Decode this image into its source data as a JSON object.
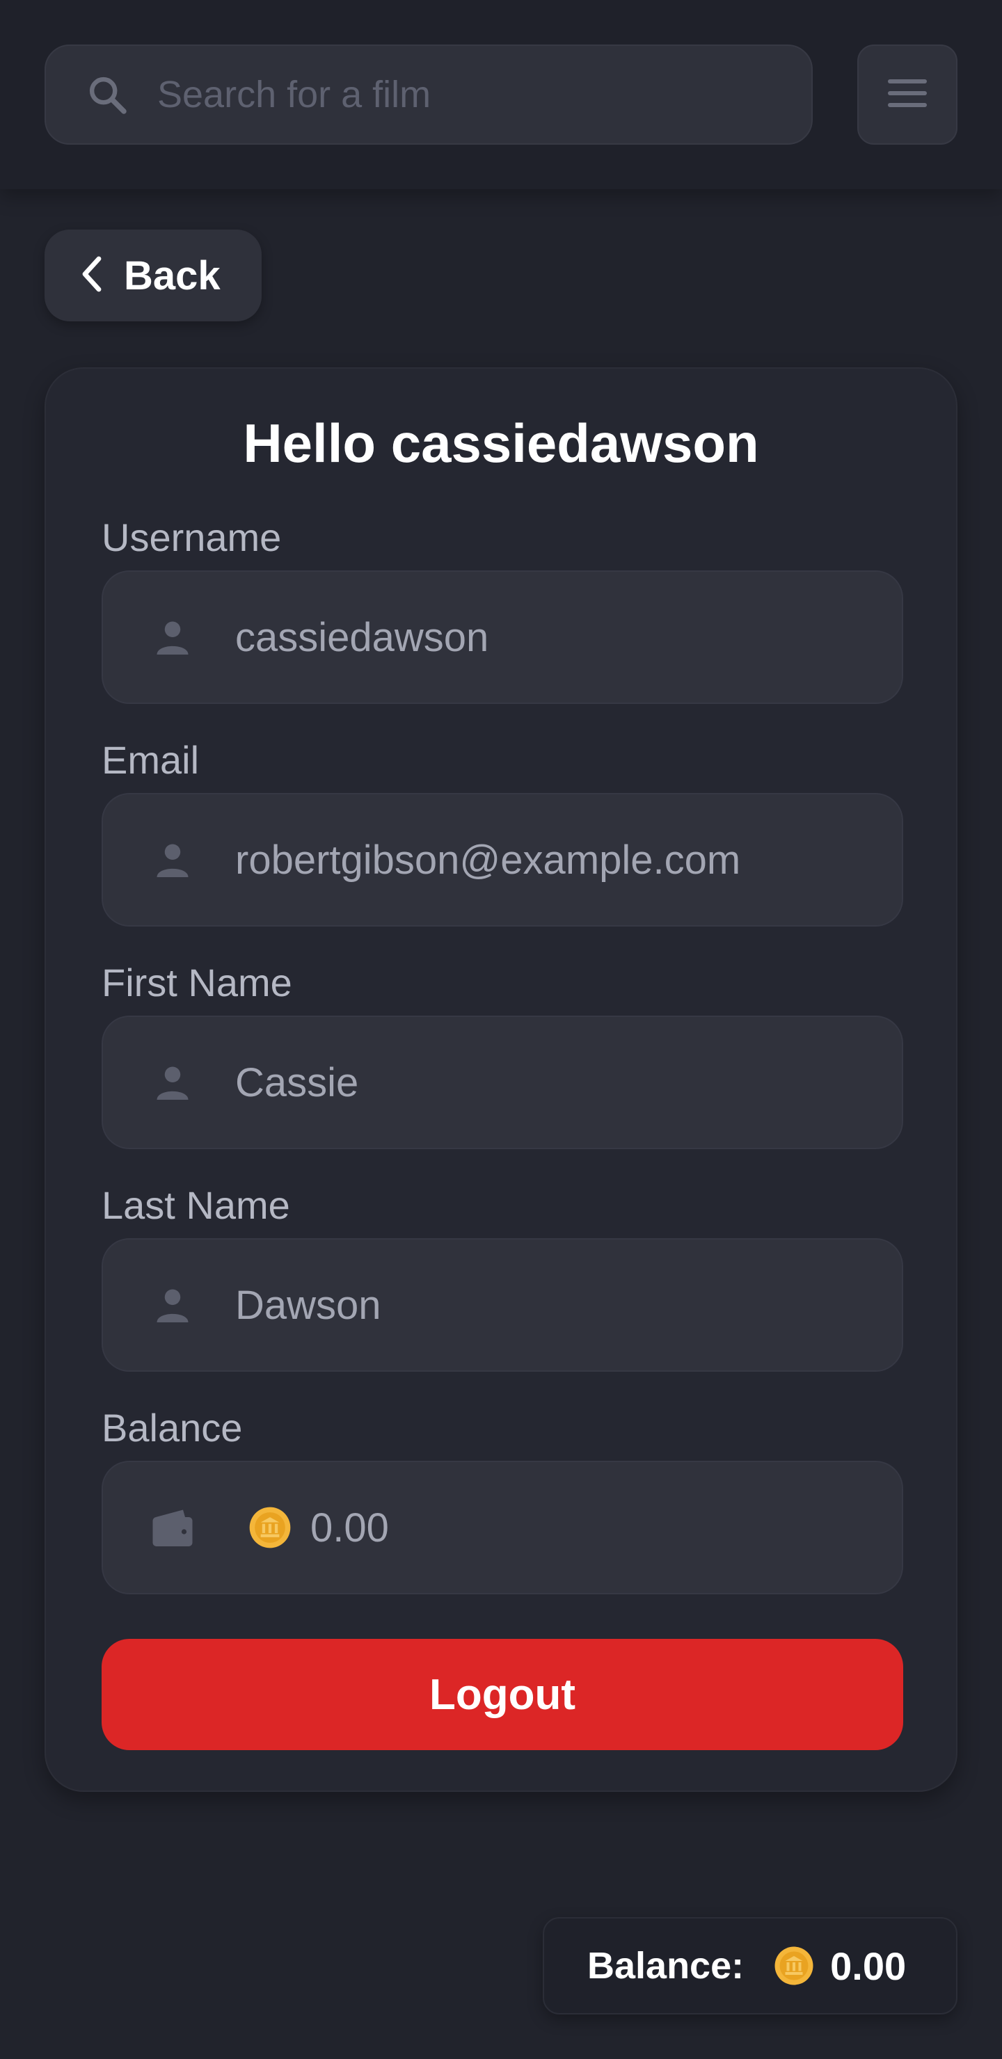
{
  "search": {
    "placeholder": "Search for a film",
    "icon": "search-icon"
  },
  "header": {
    "menu_icon": "hamburger-menu-icon"
  },
  "back": {
    "label": "Back",
    "icon": "chevron-left-icon"
  },
  "profile": {
    "greeting": "Hello cassiedawson",
    "fields": [
      {
        "label": "Username",
        "value": "cassiedawson",
        "icon": "user-icon"
      },
      {
        "label": "Email",
        "value": "robertgibson@example.com",
        "icon": "user-icon"
      },
      {
        "label": "First Name",
        "value": "Cassie",
        "icon": "user-icon"
      },
      {
        "label": "Last Name",
        "value": "Dawson",
        "icon": "user-icon"
      },
      {
        "label": "Balance",
        "value": "0.00",
        "icon": "wallet-icon",
        "coin_icon": "coin-icon"
      }
    ],
    "logout_label": "Logout"
  },
  "footer_balance": {
    "label": "Balance:",
    "value": "0.00",
    "coin_icon": "coin-icon"
  },
  "colors": {
    "background": "#21232c",
    "card": "#252731",
    "field": "#30323c",
    "logout": "#dc2626",
    "coin": "#f4b63a"
  }
}
